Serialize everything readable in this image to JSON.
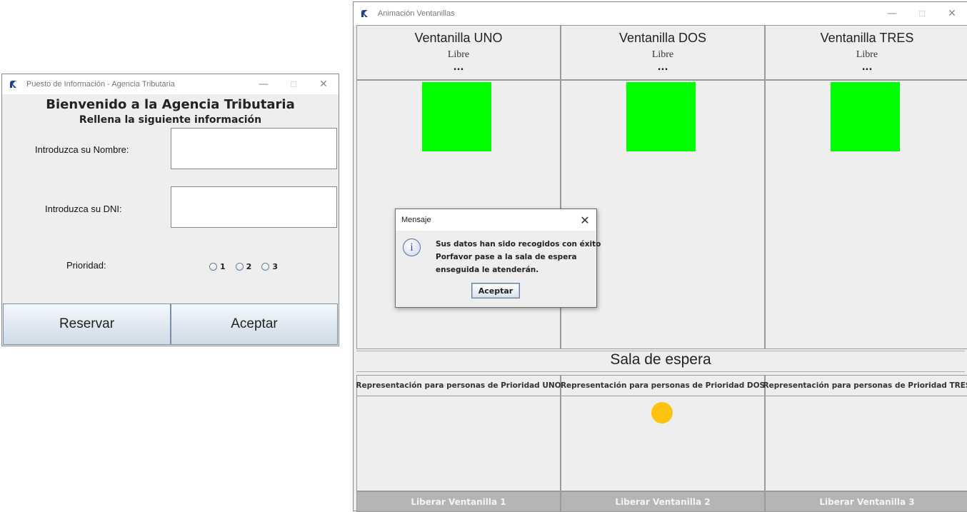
{
  "info_window": {
    "title": "Puesto de Información - Agencia Tributaria",
    "heading": "Bienvenido a la Agencia Tributaria",
    "subheading": "Rellena la siguiente información",
    "name_label": "Introduzca su Nombre:",
    "name_value": "",
    "dni_label": "Introduzca su DNI:",
    "dni_value": "",
    "priority_label": "Prioridad:",
    "priority_options": [
      "1",
      "2",
      "3"
    ],
    "reserve_button": "Reservar",
    "accept_button": "Aceptar"
  },
  "anim_window": {
    "title": "Animación Ventanillas",
    "windows": [
      {
        "title": "Ventanilla UNO",
        "status": "Libre",
        "detail": "...",
        "color": "#00ff00"
      },
      {
        "title": "Ventanilla DOS",
        "status": "Libre",
        "detail": "...",
        "color": "#00ff00"
      },
      {
        "title": "Ventanilla TRES",
        "status": "Libre",
        "detail": "...",
        "color": "#00ff00"
      }
    ],
    "waiting_room_title": "Sala de espera",
    "priority_headers": [
      "Representación para personas de Prioridad UNO",
      "Representación para personas de Prioridad DOS",
      "Representación para personas de Prioridad TRES"
    ],
    "waiting_person_color": "#ffc20e",
    "release_buttons": [
      "Liberar Ventanilla 1",
      "Liberar Ventanilla 2",
      "Liberar Ventanilla 3"
    ]
  },
  "dialog": {
    "title": "Mensaje",
    "icon": "info-icon",
    "lines": [
      "Sus datos han sido recogidos con éxito",
      "Porfavor pase a la sala de espera",
      "enseguida le atenderán."
    ],
    "ok_button": "Aceptar"
  },
  "window_controls": {
    "minimize": "—",
    "maximize": "☐",
    "close": "✕"
  }
}
